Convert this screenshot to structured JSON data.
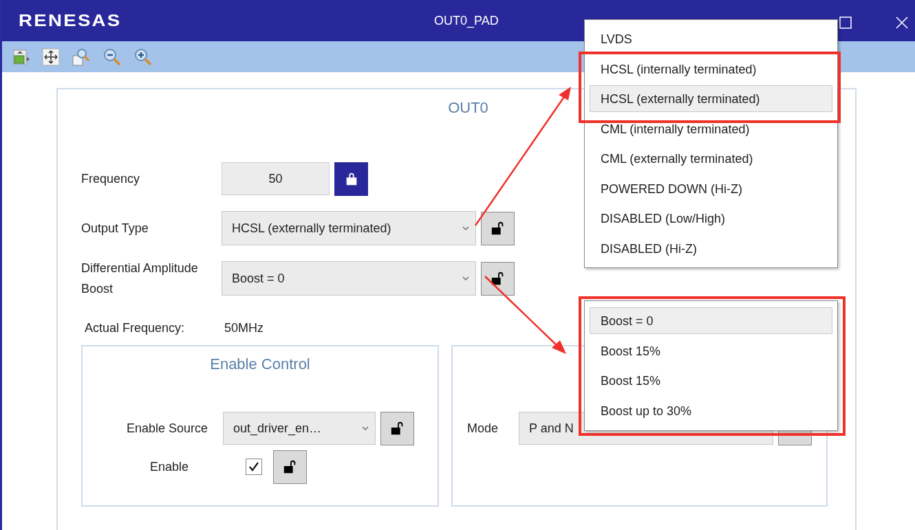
{
  "window": {
    "logo": "RENESAS",
    "title": "OUT0_PAD"
  },
  "panel": {
    "title": "OUT0",
    "frequency": {
      "label": "Frequency",
      "value": "50",
      "locked": true
    },
    "output_type": {
      "label": "Output Type",
      "value": "HCSL (externally terminated)",
      "locked": false
    },
    "amplitude_boost": {
      "label": "Differential Amplitude Boost",
      "value": "Boost = 0",
      "locked": false
    },
    "actual_frequency": {
      "label": "Actual Frequency:",
      "value": "50MHz"
    },
    "enable_control": {
      "title": "Enable Control",
      "source": {
        "label": "Enable Source",
        "value": "out_driver_en…",
        "locked": false
      },
      "enable": {
        "label": "Enable",
        "checked": true,
        "locked": false
      }
    },
    "mode_group": {
      "mode": {
        "label": "Mode",
        "value": "P and N",
        "locked": false
      }
    }
  },
  "output_type_menu": {
    "items": [
      {
        "label": "LVDS",
        "selected": false
      },
      {
        "label": "HCSL (internally terminated)",
        "selected": false
      },
      {
        "label": "HCSL (externally terminated)",
        "selected": true
      },
      {
        "label": "CML (internally terminated)",
        "selected": false
      },
      {
        "label": "CML (externally terminated)",
        "selected": false
      },
      {
        "label": "POWERED DOWN (Hi-Z)",
        "selected": false
      },
      {
        "label": "DISABLED (Low/High)",
        "selected": false
      },
      {
        "label": "DISABLED (Hi-Z)",
        "selected": false
      }
    ]
  },
  "boost_menu": {
    "items": [
      {
        "label": "Boost = 0",
        "selected": true
      },
      {
        "label": "Boost 15%",
        "selected": false
      },
      {
        "label": "Boost 15%",
        "selected": false
      },
      {
        "label": "Boost up to 30%",
        "selected": false
      }
    ]
  }
}
